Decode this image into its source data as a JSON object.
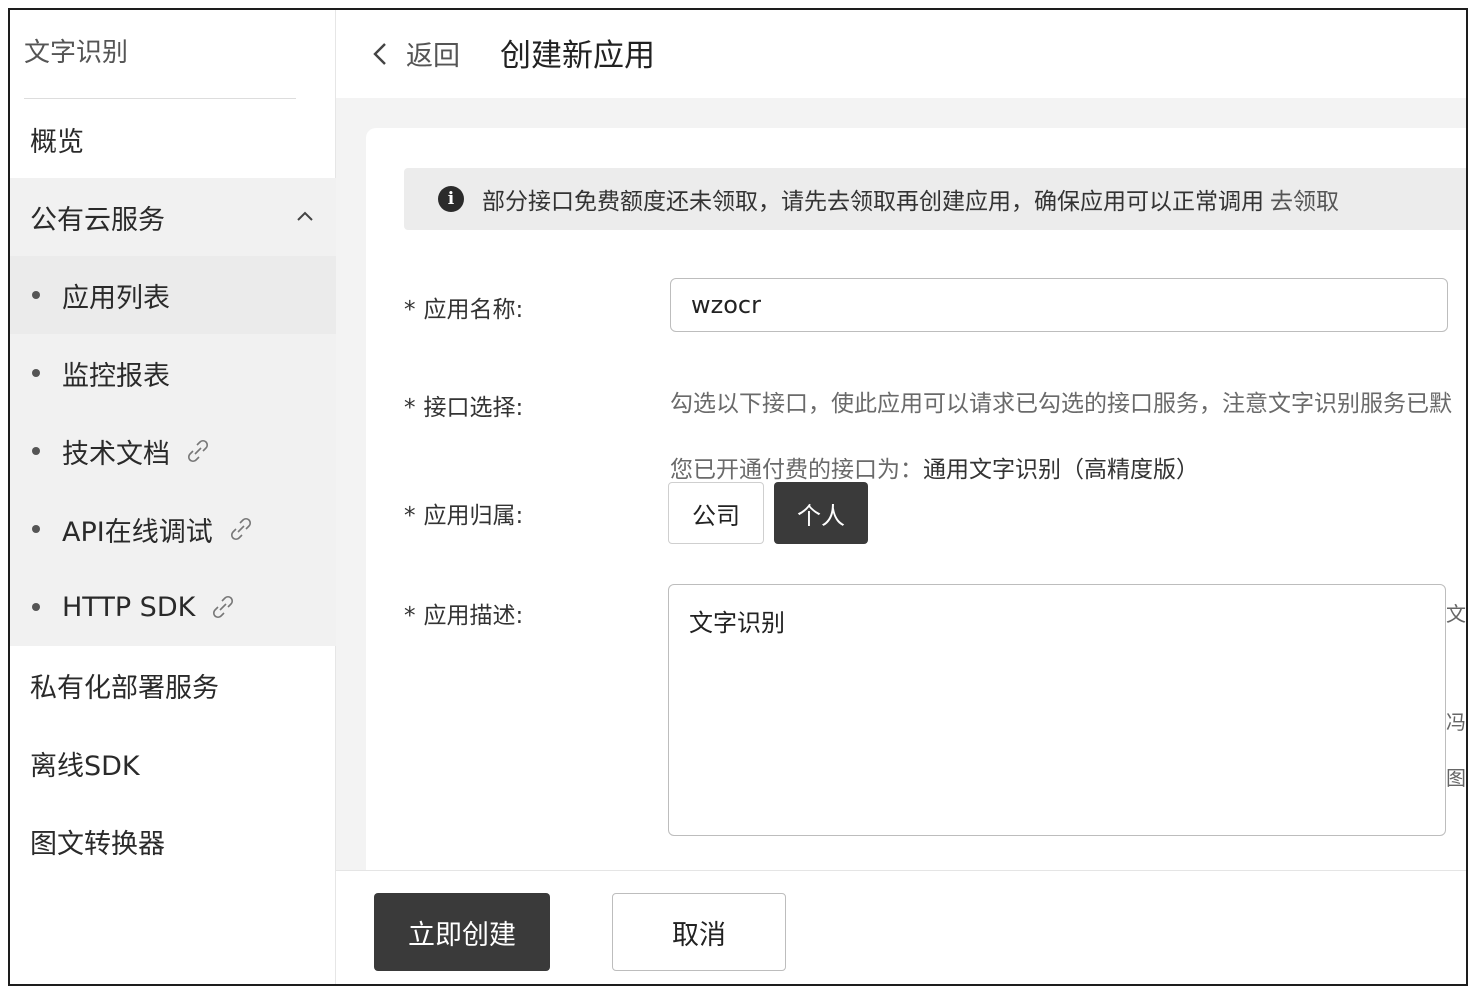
{
  "sidebar": {
    "title": "文字识别",
    "items": [
      {
        "label": "概览"
      },
      {
        "label": "公有云服务"
      },
      {
        "label": "私有化部署服务"
      },
      {
        "label": "离线SDK"
      },
      {
        "label": "图文转换器"
      }
    ],
    "sub_items": [
      {
        "label": "应用列表"
      },
      {
        "label": "监控报表"
      },
      {
        "label": "技术文档"
      },
      {
        "label": "API在线调试"
      },
      {
        "label": "HTTP SDK"
      }
    ]
  },
  "header": {
    "back_label": "返回",
    "title": "创建新应用"
  },
  "notice": {
    "text": "部分接口免费额度还未领取，请先去领取再创建应用，确保应用可以正常调用",
    "link": "去领取"
  },
  "form": {
    "app_name": {
      "label": "应用名称:",
      "value": "wzocr"
    },
    "api_select": {
      "label": "接口选择:",
      "hint": "勾选以下接口，使此应用可以请求已勾选的接口服务，注意文字识别服务已默",
      "paid_prefix": "您已开通付费的接口为：",
      "paid_value": "通用文字识别（高精度版）"
    },
    "owner": {
      "label": "应用归属:",
      "options": [
        "公司",
        "个人"
      ],
      "selected": "个人"
    },
    "description": {
      "label": "应用描述:",
      "value": "文字识别"
    },
    "required_mark": "*",
    "side_chars": [
      "文",
      "冯",
      "图"
    ]
  },
  "footer": {
    "create_label": "立即创建",
    "cancel_label": "取消"
  }
}
